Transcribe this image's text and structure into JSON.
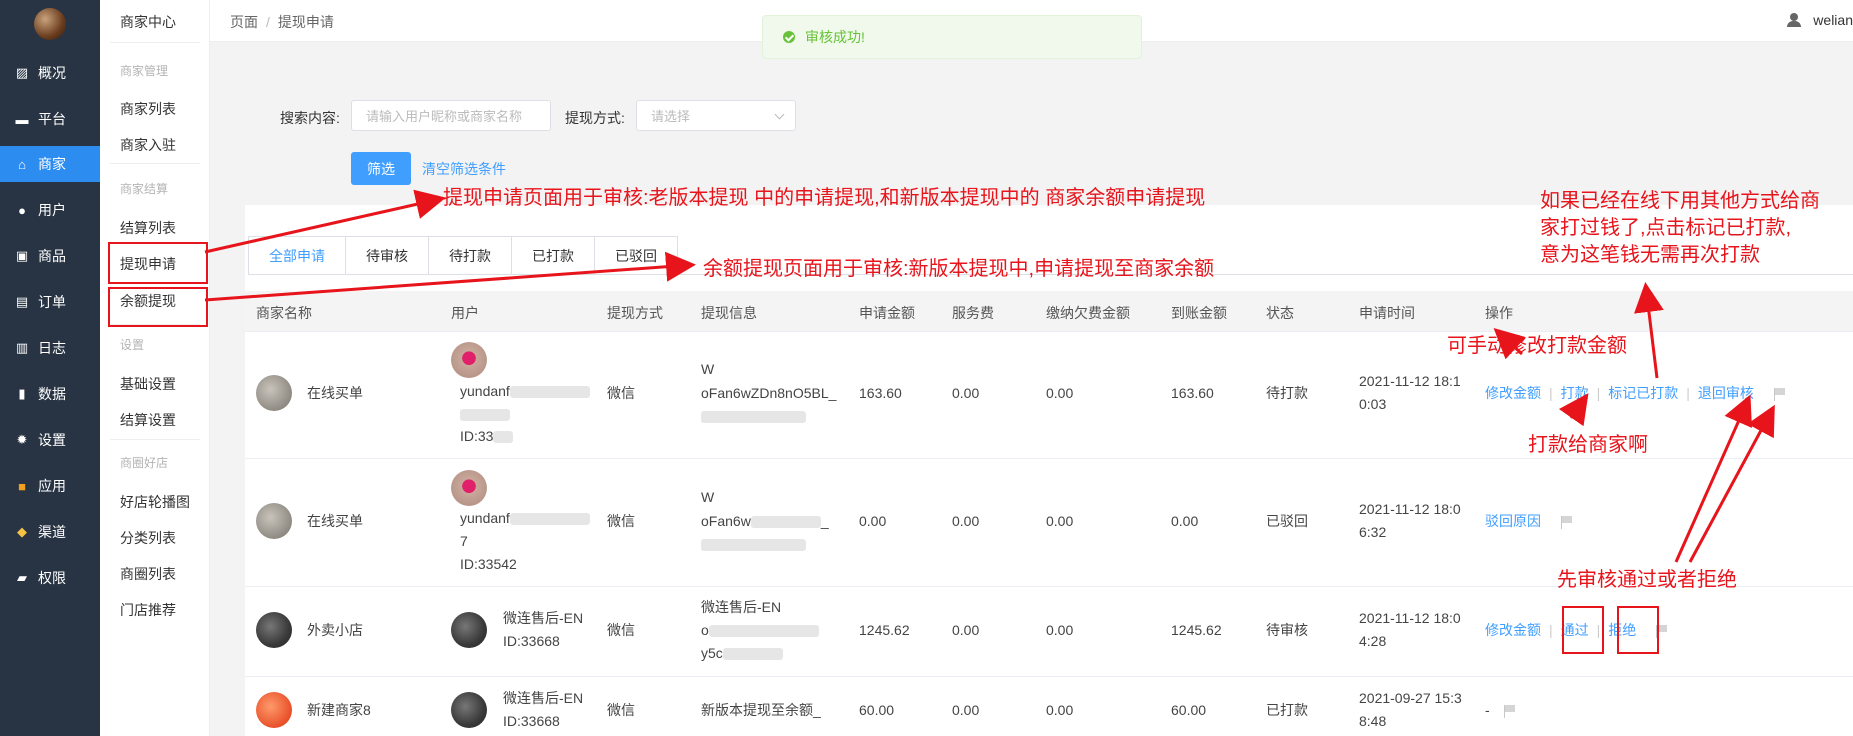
{
  "sidebar": {
    "items": [
      {
        "label": "概况",
        "icon": "chart-icon"
      },
      {
        "label": "平台",
        "icon": "monitor-icon"
      },
      {
        "label": "商家",
        "icon": "store-icon"
      },
      {
        "label": "用户",
        "icon": "user-icon"
      },
      {
        "label": "商品",
        "icon": "goods-icon"
      },
      {
        "label": "订单",
        "icon": "order-icon"
      },
      {
        "label": "日志",
        "icon": "log-icon"
      },
      {
        "label": "数据",
        "icon": "bar-chart-icon"
      },
      {
        "label": "设置",
        "icon": "gear-icon"
      },
      {
        "label": "应用",
        "icon": "apps-icon"
      },
      {
        "label": "渠道",
        "icon": "cube-icon"
      },
      {
        "label": "权限",
        "icon": "lock-icon"
      }
    ],
    "active": "商家"
  },
  "subnav": {
    "title": "商家中心",
    "group1": "商家管理",
    "item_list": "商家列表",
    "item_join": "商家入驻",
    "group2": "商家结算",
    "item_settle": "结算列表",
    "item_withdraw": "提现申请",
    "item_balance": "余额提现",
    "group3": "设置",
    "item_basic": "基础设置",
    "item_settle_set": "结算设置",
    "group4": "商圈好店",
    "item_banner": "好店轮播图",
    "item_category": "分类列表",
    "item_circle": "商圈列表",
    "item_recommend": "门店推荐"
  },
  "header": {
    "crumb_root": "页面",
    "crumb_sep": "/",
    "crumb_current": "提现申请",
    "username": "welian"
  },
  "toast": {
    "text": "审核成功!"
  },
  "filter": {
    "search_label": "搜索内容:",
    "search_placeholder": "请输入用户昵称或商家名称",
    "method_label": "提现方式:",
    "method_placeholder": "请选择",
    "filter_button": "筛选",
    "clear_link": "清空筛选条件"
  },
  "tabs": [
    "全部申请",
    "待审核",
    "待打款",
    "已打款",
    "已驳回"
  ],
  "table": {
    "columns": [
      "商家名称",
      "用户",
      "提现方式",
      "提现信息",
      "申请金额",
      "服务费",
      "缴纳欠费金额",
      "到账金额",
      "状态",
      "申请时间",
      "操作"
    ],
    "rows": [
      {
        "merchant": "在线买单",
        "user_line1": "yundanf",
        "user_line2": "",
        "user_id": "ID:33",
        "method": "微信",
        "info1": "W",
        "info2": "oFan6wZDn8nO5BL_",
        "amount": "163.60",
        "fee": "0.00",
        "debt": "0.00",
        "received": "163.60",
        "status": "待打款",
        "time1": "2021-11-12 18:1",
        "time2": "0:03",
        "actions": [
          "修改金额",
          "打款",
          "标记已打款",
          "退回审核"
        ]
      },
      {
        "merchant": "在线买单",
        "user_line1": "yundanf",
        "user_line2": "7",
        "user_id": "ID:33542",
        "method": "微信",
        "info1": "W",
        "info2": "oFan6w",
        "info2_tail": "_",
        "amount": "0.00",
        "fee": "0.00",
        "debt": "0.00",
        "received": "0.00",
        "status": "已驳回",
        "time1": "2021-11-12 18:0",
        "time2": "6:32",
        "actions": [
          "驳回原因"
        ]
      },
      {
        "merchant": "外卖小店",
        "user_line1": "微连售后-EN",
        "user_id": "ID:33668",
        "method": "微信",
        "info1": "微连售后-EN",
        "info2": "o",
        "info3": "y5c",
        "amount": "1245.62",
        "fee": "0.00",
        "debt": "0.00",
        "received": "1245.62",
        "status": "待审核",
        "time1": "2021-11-12 18:0",
        "time2": "4:28",
        "actions": [
          "修改金额",
          "通过",
          "拒绝"
        ]
      },
      {
        "merchant": "新建商家8",
        "user_line1": "微连售后-EN",
        "user_id": "ID:33668",
        "method": "微信",
        "info1": "新版本提现至余额_",
        "amount": "60.00",
        "fee": "0.00",
        "debt": "0.00",
        "received": "60.00",
        "status": "已打款",
        "time1": "2021-09-27 15:3",
        "time2": "8:48",
        "actions": [
          "-"
        ]
      }
    ]
  },
  "annotations": {
    "a1": "提现申请页面用于审核:老版本提现 中的申请提现,和新版本提现中的 商家余额申请提现",
    "a2": "余额提现页面用于审核:新版本提现中,申请提现至商家余额",
    "a3_line1": "如果已经在线下用其他方式给商",
    "a3_line2": "家打过钱了,点击标记已打款,",
    "a3_line3": "意为这笔钱无需再次打款",
    "a4": "可手动修改打款金额",
    "a5": "打款给商家啊",
    "a6": "先审核通过或者拒绝"
  },
  "colors": {
    "sidebar": "#283443",
    "accent": "#2d8cf0",
    "link": "#409eff",
    "annotation": "#e8141b"
  }
}
